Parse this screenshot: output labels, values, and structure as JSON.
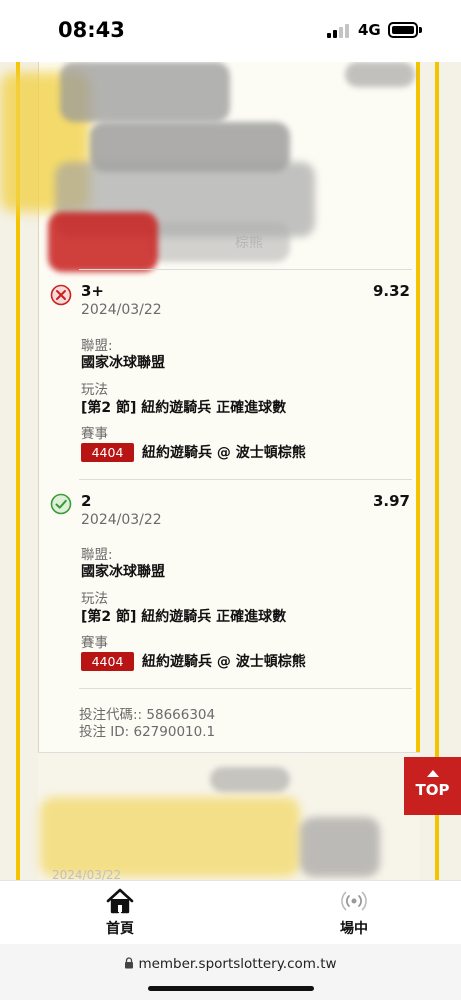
{
  "status_bar": {
    "time": "08:43",
    "network": "4G"
  },
  "background": {
    "faint_header": "棕熊",
    "faint_date": "2024/03/22"
  },
  "bets": [
    {
      "status": "lost",
      "status_icon": "cross-circle-icon",
      "title": "3+",
      "odds": "9.32",
      "date": "2024/03/22",
      "league_label": "聯盟:",
      "league": "國家冰球聯盟",
      "market_label": "玩法",
      "market": "[第2 節] 紐約遊騎兵 正確進球數",
      "event_label": "賽事",
      "event_code": "4404",
      "event": "紐約遊騎兵 @ 波士頓棕熊"
    },
    {
      "status": "won",
      "status_icon": "check-circle-icon",
      "title": "2",
      "odds": "3.97",
      "date": "2024/03/22",
      "league_label": "聯盟:",
      "league": "國家冰球聯盟",
      "market_label": "玩法",
      "market": "[第2 節] 紐約遊騎兵 正確進球數",
      "event_label": "賽事",
      "event_code": "4404",
      "event": "紐約遊騎兵 @ 波士頓棕熊"
    }
  ],
  "ticket": {
    "code_line": "投注代碼:: 58666304",
    "id_line": "投注 ID: 62790010.1"
  },
  "top_button": {
    "label": "TOP"
  },
  "tab_bar": {
    "home_label": "首頁",
    "live_label": "場中"
  },
  "browser": {
    "url": "member.sportslottery.com.tw"
  },
  "colors": {
    "accent_red": "#c8201e",
    "gold": "#f5c400",
    "badge_red": "#b81414",
    "won_green": "#3a9a3a"
  }
}
